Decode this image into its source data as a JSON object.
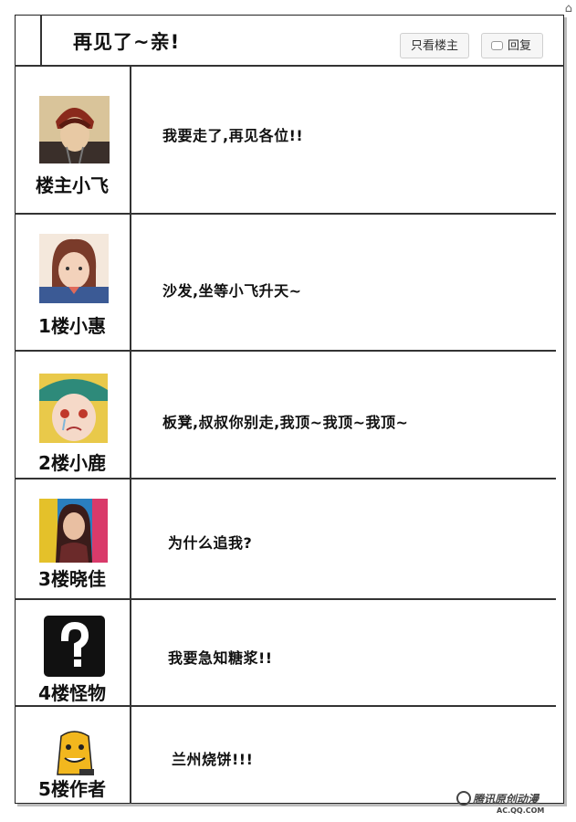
{
  "header": {
    "title": "再见了~亲!",
    "only_op_label": "只看楼主",
    "reply_label": "回复"
  },
  "posts": [
    {
      "name": "楼主小飞",
      "message": "我要走了,再见各位!!",
      "avatar_icon": "avatar-boy-icon"
    },
    {
      "name": "1楼小惠",
      "message": "沙发,坐等小飞升天~",
      "avatar_icon": "avatar-girl-uniform-icon"
    },
    {
      "name": "2楼小鹿",
      "message": "板凳,叔叔你别走,我顶~我顶~我顶~",
      "avatar_icon": "avatar-crying-girl-icon"
    },
    {
      "name": "3楼晓佳",
      "message": "为什么追我?",
      "avatar_icon": "avatar-woman-icon"
    },
    {
      "name": "4楼怪物",
      "message": "我要急知糖浆!!",
      "avatar_icon": "question-mark-icon"
    },
    {
      "name": "5楼作者",
      "message": "兰州烧饼!!!",
      "avatar_icon": "avatar-cartoon-icon"
    }
  ],
  "watermark": {
    "brand": "腾讯原创动漫",
    "site": "AC.QQ.COM"
  },
  "colors": {
    "border": "#333333",
    "button_bg": "#f6f6f6"
  }
}
